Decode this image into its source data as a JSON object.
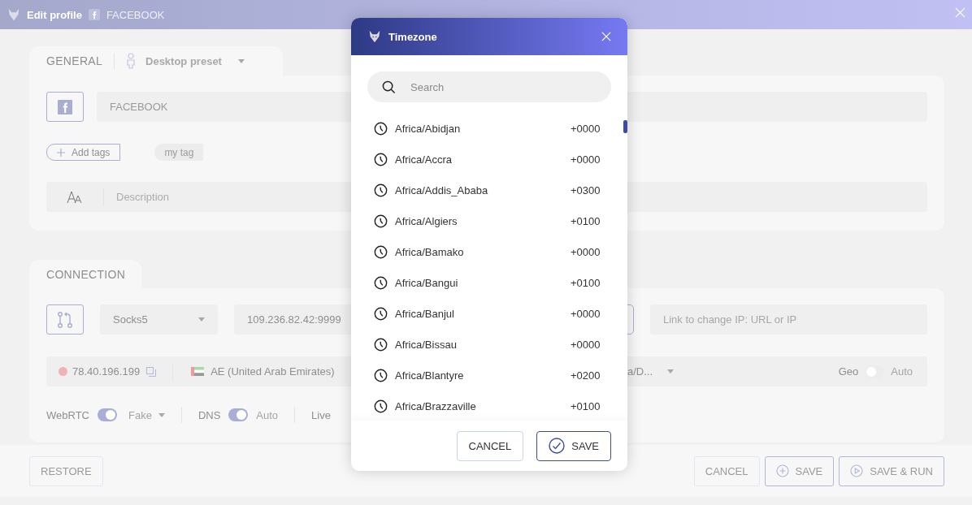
{
  "window": {
    "title": "Edit profile",
    "profile_name": "FACEBOOK"
  },
  "general": {
    "tab": "GENERAL",
    "preset": "Desktop preset",
    "name_value": "FACEBOOK",
    "add_tags": "Add tags",
    "tags": [
      "my tag"
    ],
    "description_placeholder": "Description"
  },
  "connection": {
    "tab": "CONNECTION",
    "proxy_type": "Socks5",
    "proxy_value": "109.236.82.42:9999",
    "change_ip_placeholder": "Link to change IP: URL or IP",
    "ip": "78.40.196.199",
    "country": "AE (United Arab Emirates)",
    "timezone_value": "a/D...",
    "geo": {
      "label": "Geo",
      "on": false,
      "mode": "Auto"
    },
    "webrtc": {
      "label": "WebRTC",
      "on": true,
      "mode": "Fake"
    },
    "dns": {
      "label": "DNS",
      "on": true,
      "mode": "Auto"
    },
    "live_label": "Live"
  },
  "footer": {
    "restore": "RESTORE",
    "cancel": "CANCEL",
    "save": "SAVE",
    "save_run": "SAVE & RUN"
  },
  "dialog": {
    "title": "Timezone",
    "search_placeholder": "Search",
    "items": [
      {
        "name": "Africa/Abidjan",
        "offset": "+0000"
      },
      {
        "name": "Africa/Accra",
        "offset": "+0000"
      },
      {
        "name": "Africa/Addis_Ababa",
        "offset": "+0300"
      },
      {
        "name": "Africa/Algiers",
        "offset": "+0100"
      },
      {
        "name": "Africa/Bamako",
        "offset": "+0000"
      },
      {
        "name": "Africa/Bangui",
        "offset": "+0100"
      },
      {
        "name": "Africa/Banjul",
        "offset": "+0000"
      },
      {
        "name": "Africa/Bissau",
        "offset": "+0000"
      },
      {
        "name": "Africa/Blantyre",
        "offset": "+0200"
      },
      {
        "name": "Africa/Brazzaville",
        "offset": "+0100"
      }
    ],
    "cancel": "CANCEL",
    "save": "SAVE"
  }
}
